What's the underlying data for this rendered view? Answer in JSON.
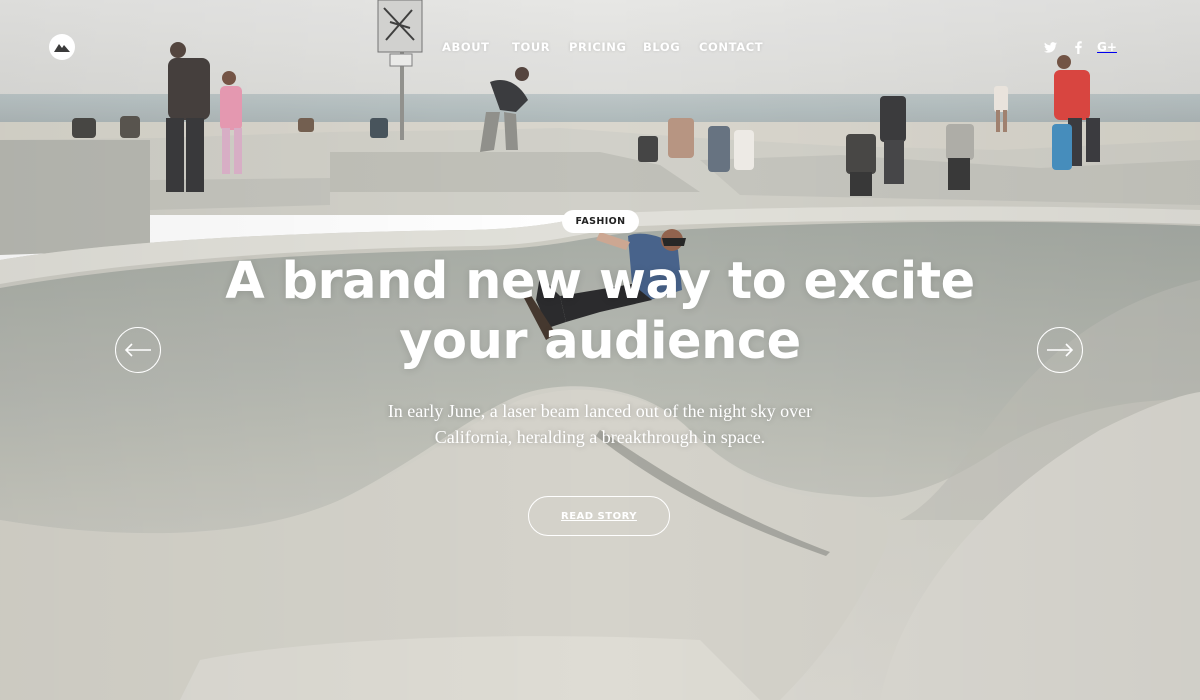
{
  "header": {
    "logo": {
      "icon": "mountain-logo-icon"
    },
    "nav": [
      {
        "id": "about",
        "label": "ABOUT"
      },
      {
        "id": "tour",
        "label": "TOUR"
      },
      {
        "id": "pricing",
        "label": "PRICING"
      },
      {
        "id": "blog",
        "label": "BLOG"
      },
      {
        "id": "contact",
        "label": "CONTACT"
      }
    ],
    "social": [
      {
        "id": "twitter",
        "icon": "twitter-icon"
      },
      {
        "id": "facebook",
        "icon": "facebook-icon"
      },
      {
        "id": "googleplus",
        "icon": "google-plus-icon",
        "label": "G+"
      }
    ]
  },
  "hero": {
    "category": "FASHION",
    "headline_line1": "A brand new way to excite",
    "headline_line2": "your audience",
    "subtitle_line1": "In early June, a laser beam lanced out of the night sky over",
    "subtitle_line2": "California, heralding a breakthrough in space.",
    "cta_label": "READ STORY",
    "prev_icon": "arrow-left-icon",
    "next_icon": "arrow-right-icon",
    "background": "skatepark-photo"
  },
  "colors": {
    "text": "#ffffff",
    "badge_bg": "#ffffff",
    "badge_text": "#222222",
    "sky": "#e3e3e1",
    "sea": "#aeb8ba",
    "concrete": "#c9c9c1"
  }
}
